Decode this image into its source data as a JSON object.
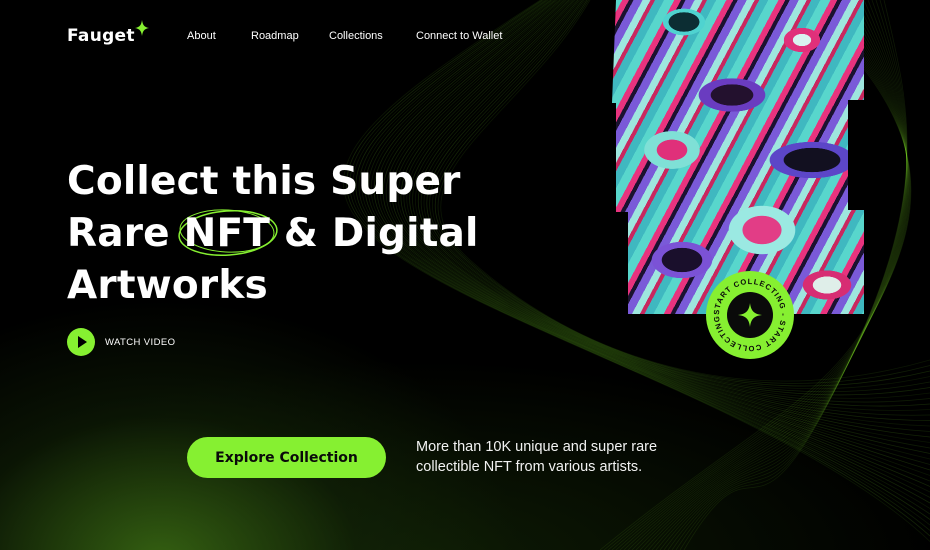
{
  "brand": {
    "name": "Fauget",
    "accent": "#86f031"
  },
  "nav": {
    "links": [
      {
        "label": "About"
      },
      {
        "label": "Roadmap"
      },
      {
        "label": "Collections"
      },
      {
        "label": "Connect to Wallet"
      }
    ]
  },
  "hero": {
    "line1": "Collect this Super",
    "line2_pre": "Rare ",
    "line2_highlight": "NFT",
    "line2_post": " & Digital",
    "line3": "Artworks",
    "watch_label": "WATCH VIDEO",
    "badge_text": "START COLLECTING - START COLLECTING - ",
    "badge_icon": "sparkle-icon"
  },
  "cta": {
    "button_label": "Explore Collection",
    "description": "More than 10K unique and super rare collectible NFT from various artists."
  }
}
